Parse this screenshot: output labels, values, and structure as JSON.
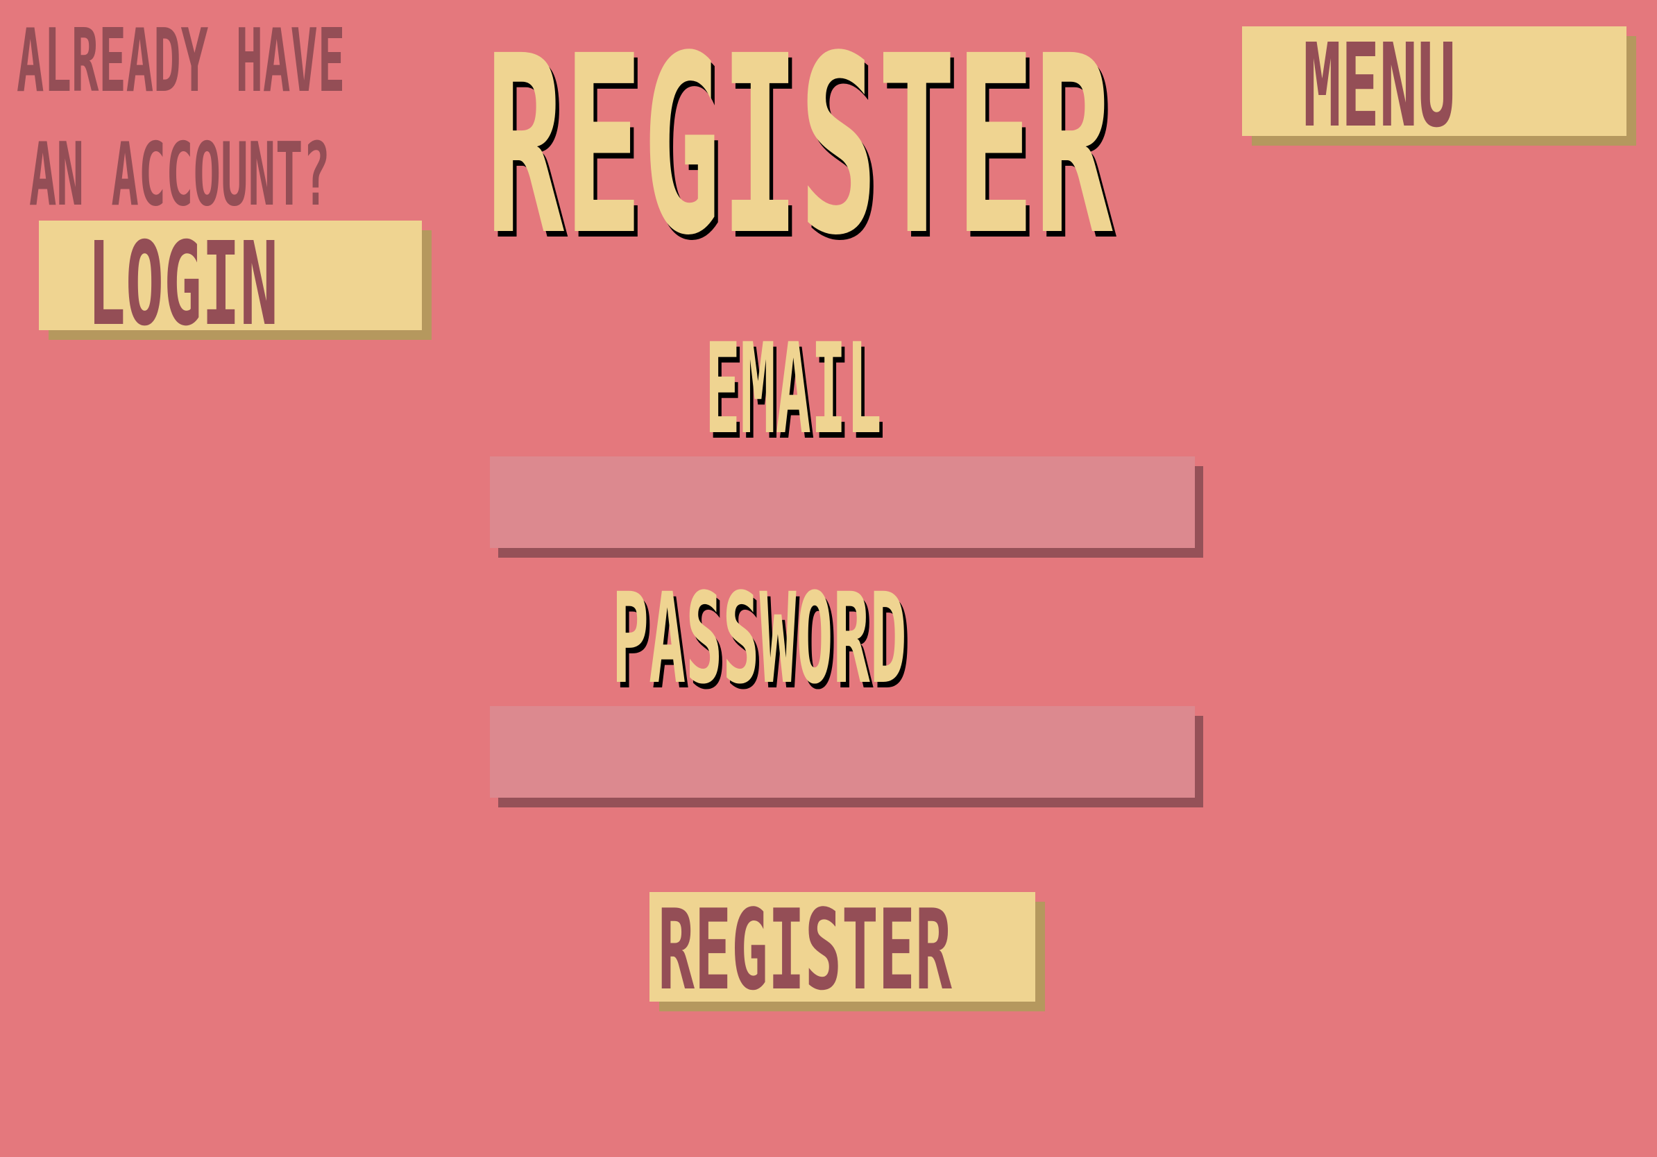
{
  "header": {
    "title": "REGISTER"
  },
  "login_prompt": {
    "line1": "ALREADY HAVE",
    "line2": "AN ACCOUNT?",
    "button_label": "LOGIN"
  },
  "menu": {
    "button_label": "MENU"
  },
  "form": {
    "email_label": "EMAIL",
    "email_value": "",
    "password_label": "PASSWORD",
    "password_value": "",
    "submit_label": "REGISTER"
  },
  "colors": {
    "background": "#e4787d",
    "accent_yellow": "#efd491",
    "dark_text": "#944e56",
    "input_fill": "#dc898f",
    "input_shadow": "#955158",
    "button_shadow": "#b5985e"
  }
}
